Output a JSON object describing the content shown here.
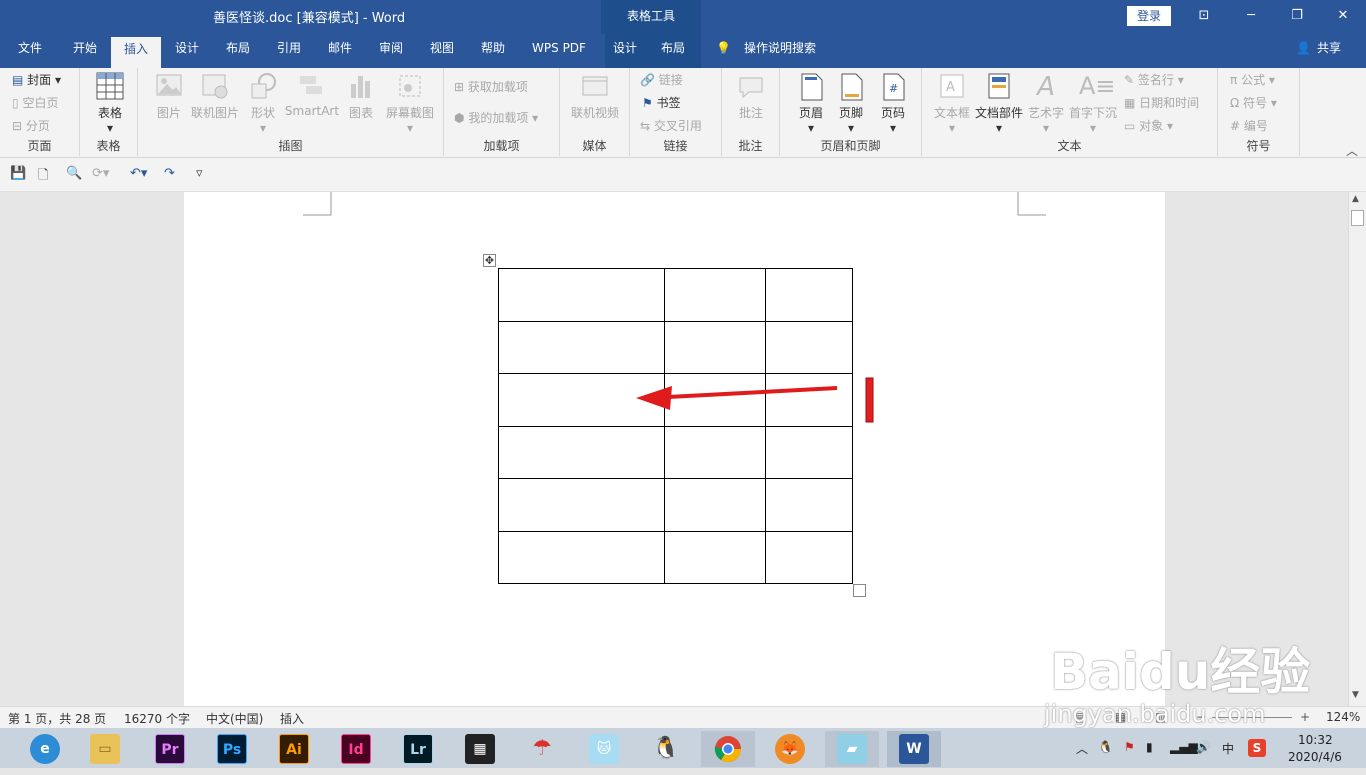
{
  "window": {
    "title": "善医怪谈.doc [兼容模式]  -  Word",
    "context_tab": "表格工具",
    "login": "登录",
    "share": "共享",
    "tell_me": "操作说明搜索"
  },
  "tabs": [
    "文件",
    "开始",
    "插入",
    "设计",
    "布局",
    "引用",
    "邮件",
    "审阅",
    "视图",
    "帮助",
    "WPS PDF",
    "设计",
    "布局"
  ],
  "ribbon": {
    "pages": {
      "label": "页面",
      "cover": "封面",
      "blank": "空白页",
      "break": "分页"
    },
    "tables": {
      "label": "表格",
      "table": "表格"
    },
    "illustrations": {
      "label": "插图",
      "items": [
        "图片",
        "联机图片",
        "形状",
        "SmartArt",
        "图表",
        "屏幕截图"
      ]
    },
    "addins": {
      "label": "加载项",
      "get": "获取加载项",
      "mine": "我的加载项"
    },
    "media": {
      "label": "媒体",
      "video": "联机视频"
    },
    "links": {
      "label": "链接",
      "link": "链接",
      "bookmark": "书签",
      "crossref": "交叉引用"
    },
    "comments": {
      "label": "批注",
      "comment": "批注"
    },
    "header_footer": {
      "label": "页眉和页脚",
      "header": "页眉",
      "footer": "页脚",
      "page_number": "页码"
    },
    "text": {
      "label": "文本",
      "items": [
        "文本框",
        "文档部件",
        "艺术字",
        "首字下沉"
      ],
      "sig": "签名行",
      "date": "日期和时间",
      "object": "对象"
    },
    "symbols": {
      "label": "符号",
      "equation": "公式",
      "symbol": "符号",
      "number": "编号"
    }
  },
  "status": {
    "page": "第 1 页，共 28 页",
    "words": "16270 个字",
    "lang": "中文(中国)",
    "mode": "插入",
    "zoom": "124%"
  },
  "taskbar": {
    "apps": [
      "Pr",
      "Ps",
      "Ai",
      "Id",
      "Lr"
    ],
    "ime": "中",
    "time": "10:32",
    "date": "2020/4/6"
  },
  "watermark": {
    "line1": "Baidu经验",
    "line2": "jingyan.baidu.com"
  },
  "table": {
    "rows": 6,
    "cols": 3
  }
}
